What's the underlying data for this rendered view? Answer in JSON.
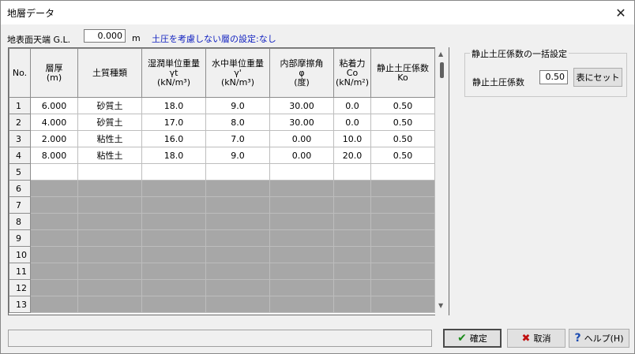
{
  "window": {
    "title": "地層データ"
  },
  "surface": {
    "label": "地表面天端 G.L.",
    "value": "0.000",
    "unit": "m"
  },
  "setting_text": "土圧を考慮しない層の設定:なし",
  "grid": {
    "headers": [
      [
        "No."
      ],
      [
        "層厚",
        "(m)"
      ],
      [
        "土質種類"
      ],
      [
        "湿潤単位重量",
        "γt",
        "(kN/m³)"
      ],
      [
        "水中単位重量",
        "γ'",
        "(kN/m³)"
      ],
      [
        "内部摩擦角",
        "φ",
        "(度)"
      ],
      [
        "粘着力",
        "Co",
        "(kN/m²)"
      ],
      [
        "静止土圧係数",
        "Ko"
      ]
    ],
    "rows": [
      [
        "1",
        "6.000",
        "砂質土",
        "18.0",
        "9.0",
        "30.00",
        "0.0",
        "0.50"
      ],
      [
        "2",
        "4.000",
        "砂質土",
        "17.0",
        "8.0",
        "30.00",
        "0.0",
        "0.50"
      ],
      [
        "3",
        "2.000",
        "粘性土",
        "16.0",
        "7.0",
        "0.00",
        "10.0",
        "0.50"
      ],
      [
        "4",
        "8.000",
        "粘性土",
        "18.0",
        "9.0",
        "0.00",
        "20.0",
        "0.50"
      ],
      [
        "5",
        "",
        "",
        "",
        "",
        "",
        "",
        ""
      ],
      [
        "6",
        "",
        "",
        "",
        "",
        "",
        "",
        ""
      ],
      [
        "7",
        "",
        "",
        "",
        "",
        "",
        "",
        ""
      ],
      [
        "8",
        "",
        "",
        "",
        "",
        "",
        "",
        ""
      ],
      [
        "9",
        "",
        "",
        "",
        "",
        "",
        "",
        ""
      ],
      [
        "10",
        "",
        "",
        "",
        "",
        "",
        "",
        ""
      ],
      [
        "11",
        "",
        "",
        "",
        "",
        "",
        "",
        ""
      ],
      [
        "12",
        "",
        "",
        "",
        "",
        "",
        "",
        ""
      ],
      [
        "13",
        "",
        "",
        "",
        "",
        "",
        "",
        ""
      ]
    ],
    "disabled_from_row": 6
  },
  "k0_group": {
    "title": "静止土圧係数の一括設定",
    "label": "静止土圧係数",
    "value": "0.50",
    "button": "表にセット"
  },
  "buttons": {
    "ok": "確定",
    "cancel": "取消",
    "help": "ヘルプ(H)"
  },
  "icons": {
    "close": "close-icon",
    "ok": "check-icon",
    "cancel": "x-icon",
    "help": "question-icon"
  },
  "colors": {
    "disabled_cell": "#a7a7a7",
    "setting_text": "#1020c0"
  }
}
